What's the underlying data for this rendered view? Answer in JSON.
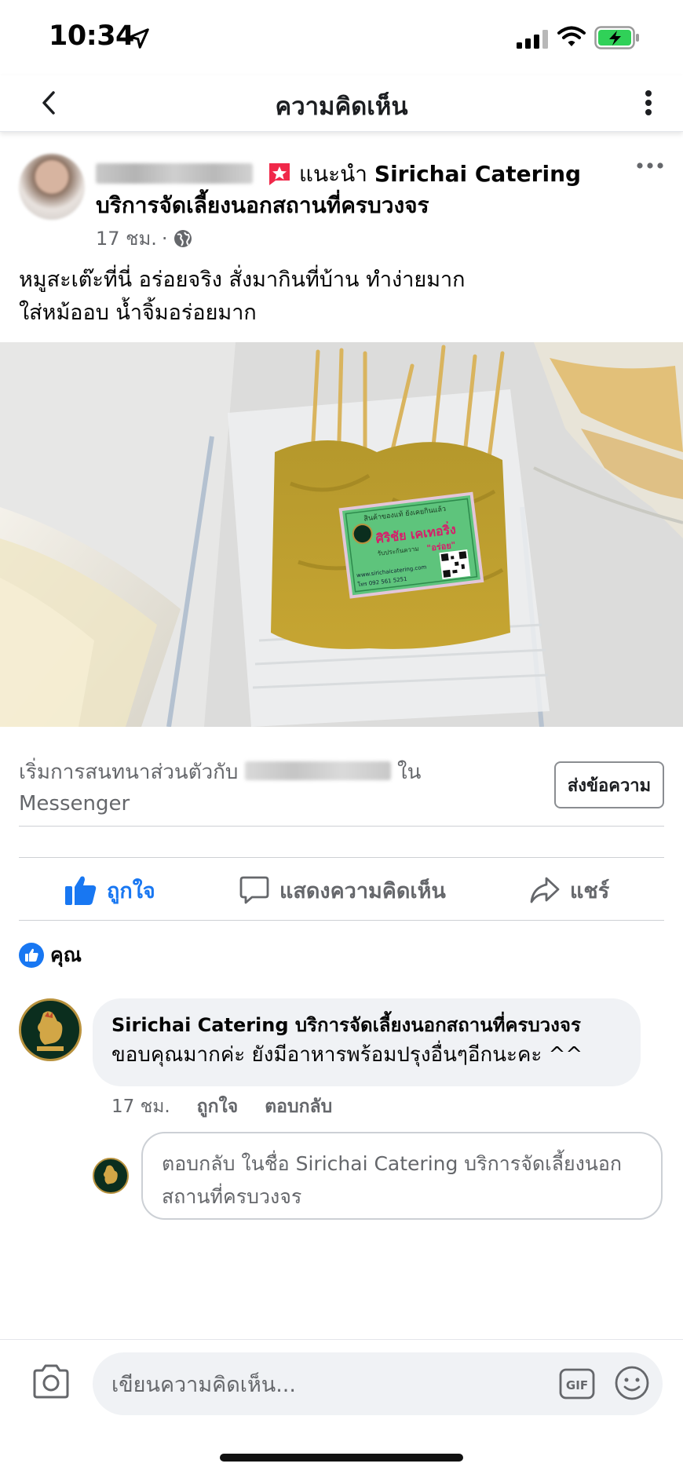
{
  "status_bar": {
    "time": "10:34"
  },
  "nav": {
    "title": "ความคิดเห็น"
  },
  "post": {
    "recommends_text": "แนะนำ",
    "page_name_line1": "Sirichai Catering",
    "page_name_line2": "บริการจัดเลี้ยงนอกสถานที่ครบวงจร",
    "time": "17 ชม.",
    "separator": "·",
    "text_line1": "หมูสะเต๊ะที่นี่ อร่อยจริง สั่งมากินที่บ้าน ทำง่ายมาก",
    "text_line2": "ใส่หม้ออบ น้ำจิ้มอร่อยมาก"
  },
  "photo_label": {
    "top": "สินค้าของแท้ ยังเคยกินแล้ว",
    "brand": "ศิริชัย เคเทอริ่ง",
    "sub": "รับประกันความ",
    "quote": "\"อร่อย\"",
    "url": "www.sirichaicatering.com",
    "tel": "โทร 092 561 5251"
  },
  "messenger": {
    "prefix": "เริ่มการสนทนาส่วนตัวกับ",
    "suffix": "ใน",
    "line2": "Messenger",
    "send_label": "ส่งข้อความ"
  },
  "actions": {
    "like": "ถูกใจ",
    "comment": "แสดงความคิดเห็น",
    "share": "แชร์"
  },
  "reactions": {
    "label": "คุณ"
  },
  "comment": {
    "author": "Sirichai Catering บริการจัดเลี้ยงนอกสถานที่ครบวงจร",
    "text": "ขอบคุณมากค่ะ ยังมีอาหารพร้อมปรุงอื่นๆอีกนะคะ ^^",
    "time": "17 ชม.",
    "like": "ถูกใจ",
    "reply": "ตอบกลับ"
  },
  "reply_box": {
    "placeholder": "ตอบกลับ ในชื่อ Sirichai Catering บริการจัดเลี้ยงนอกสถานที่ครบวงจร"
  },
  "composer": {
    "placeholder": "เขียนความคิดเห็น...",
    "gif": "GIF"
  },
  "colors": {
    "accent": "#1877f2",
    "battery": "#30d158",
    "badge": "#f02849"
  }
}
